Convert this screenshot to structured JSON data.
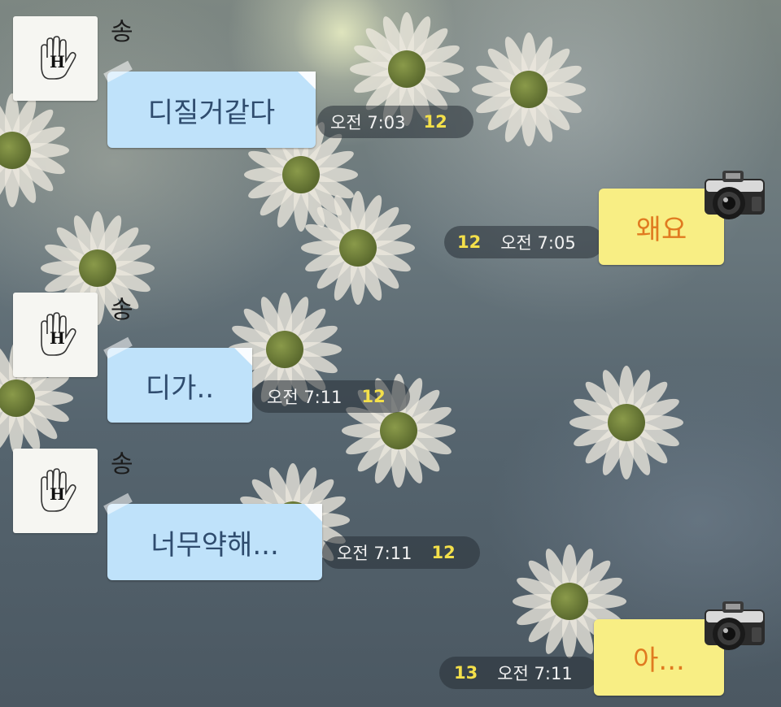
{
  "chat": {
    "messages": [
      {
        "direction": "incoming",
        "sender": "송",
        "avatar_text": "H",
        "text": "디질거같다",
        "time": "오전 7:03",
        "unread": "12"
      },
      {
        "direction": "outgoing",
        "text": "왜요",
        "time": "오전 7:05",
        "unread": "12",
        "sticker_icon": "camera-icon"
      },
      {
        "direction": "incoming",
        "sender": "송",
        "avatar_text": "H",
        "text": "디가..",
        "time": "오전 7:11",
        "unread": "12"
      },
      {
        "direction": "incoming",
        "sender": "송",
        "avatar_text": "H",
        "text": "너무약해...",
        "time": "오전 7:11",
        "unread": "12"
      },
      {
        "direction": "outgoing",
        "text": "아...",
        "time": "오전 7:11",
        "unread": "13",
        "sticker_icon": "camera-icon"
      }
    ]
  },
  "colors": {
    "incoming_bubble": "#bfe2fa",
    "outgoing_bubble": "#f8ee84",
    "unread_count": "#f4e04a"
  }
}
